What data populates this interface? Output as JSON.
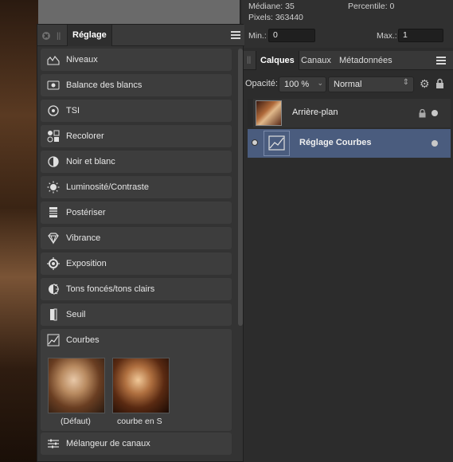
{
  "histogram": {
    "median_label": "Médiane: 35",
    "percentile_label": "Percentile: 0",
    "pixels_label": "Pixels: 363440",
    "min_label": "Min.:",
    "min_value": "0",
    "max_label": "Max.:",
    "max_value": "1"
  },
  "layers_panel": {
    "tabs": [
      "Calques",
      "Canaux",
      "Métadonnées"
    ],
    "active_tab": "Calques",
    "opacity_label": "Opacité:",
    "opacity_value": "100 %",
    "blend_mode": "Normal",
    "layers": [
      {
        "name": "Arrière-plan",
        "locked": true,
        "selected": false
      },
      {
        "name": "Réglage Courbes",
        "locked": false,
        "selected": true
      }
    ]
  },
  "adjustment_panel": {
    "title": "Réglage",
    "items": [
      {
        "label": "Niveaux",
        "icon": "levels-icon"
      },
      {
        "label": "Balance des blancs",
        "icon": "white-balance-icon"
      },
      {
        "label": "TSI",
        "icon": "hsl-icon"
      },
      {
        "label": "Recolorer",
        "icon": "recolor-icon"
      },
      {
        "label": "Noir et blanc",
        "icon": "black-white-icon"
      },
      {
        "label": "Luminosité/Contraste",
        "icon": "brightness-icon"
      },
      {
        "label": "Postériser",
        "icon": "posterize-icon"
      },
      {
        "label": "Vibrance",
        "icon": "vibrance-icon"
      },
      {
        "label": "Exposition",
        "icon": "exposure-icon"
      },
      {
        "label": "Tons foncés/tons clairs",
        "icon": "shadows-highlights-icon"
      },
      {
        "label": "Seuil",
        "icon": "threshold-icon"
      }
    ],
    "curves": {
      "label": "Courbes",
      "icon": "curves-icon",
      "presets": [
        "(Défaut)",
        "courbe en S"
      ]
    },
    "last_item": {
      "label": "Mélangeur de canaux",
      "icon": "channel-mixer-icon"
    }
  }
}
